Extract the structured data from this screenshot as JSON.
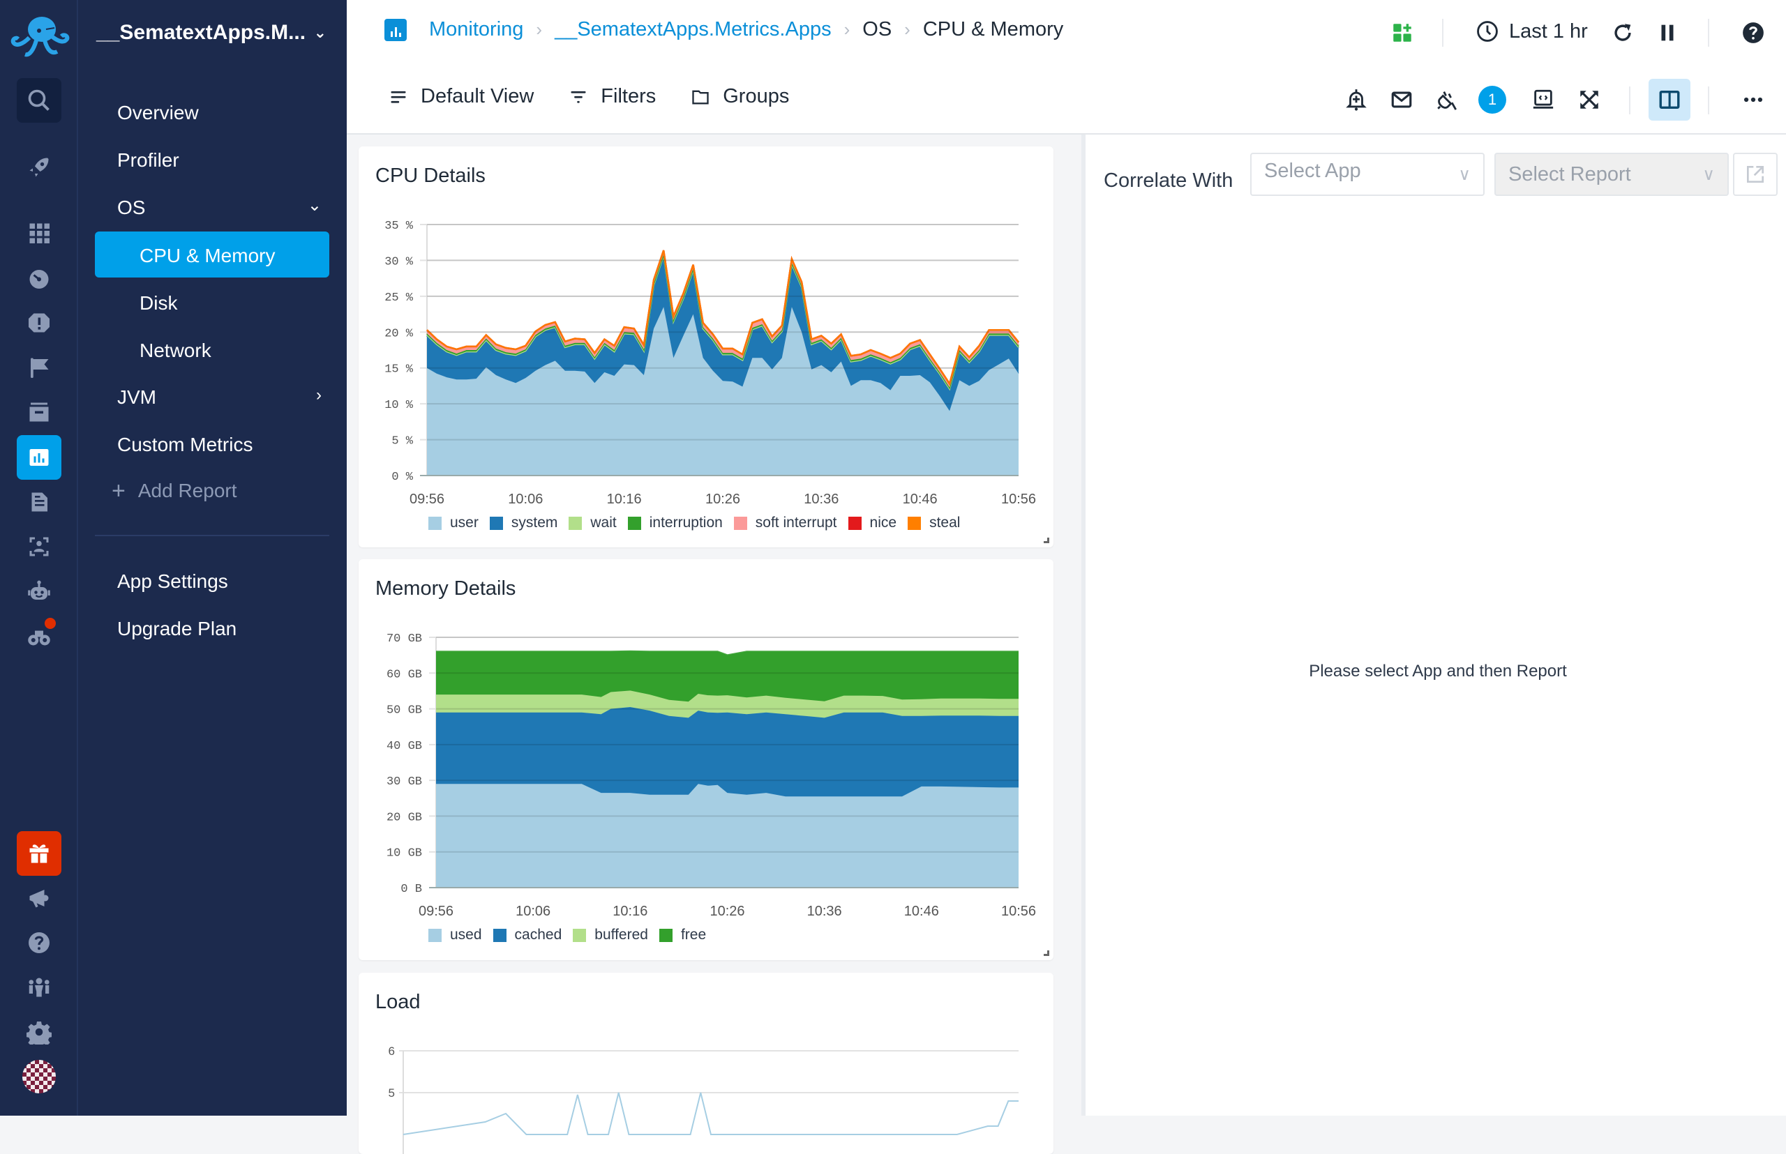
{
  "app": {
    "name": "__SematextApps.M...",
    "logo": "octopus-logo"
  },
  "rail": {
    "items": [
      {
        "name": "search-icon",
        "active": false
      },
      {
        "name": "rocket-icon",
        "active": false
      },
      {
        "name": "apps-grid-icon",
        "active": false
      },
      {
        "name": "dashboard-gauge-icon",
        "active": false
      },
      {
        "name": "alert-icon",
        "active": false
      },
      {
        "name": "flag-icon",
        "active": false
      },
      {
        "name": "archive-icon",
        "active": false
      },
      {
        "name": "monitoring-chart-icon",
        "active": true
      },
      {
        "name": "logs-document-icon",
        "active": false
      },
      {
        "name": "experience-user-scan-icon",
        "active": false
      },
      {
        "name": "synthetics-robot-icon",
        "active": false
      },
      {
        "name": "discover-binoculars-icon",
        "active": false,
        "notification": true
      }
    ],
    "bottom": [
      {
        "name": "gift-icon"
      },
      {
        "name": "announcements-megaphone-icon"
      },
      {
        "name": "help-icon"
      },
      {
        "name": "team-icon"
      },
      {
        "name": "settings-gear-icon"
      },
      {
        "name": "user-avatar"
      }
    ]
  },
  "nav": {
    "items": [
      {
        "label": "Overview"
      },
      {
        "label": "Profiler"
      },
      {
        "label": "OS",
        "expanded": true
      },
      {
        "label": "CPU & Memory",
        "active": true
      },
      {
        "label": "Disk"
      },
      {
        "label": "Network"
      },
      {
        "label": "JVM",
        "expanded": false
      },
      {
        "label": "Custom Metrics"
      },
      {
        "label": "Add Report"
      },
      {
        "label": "App Settings"
      },
      {
        "label": "Upgrade Plan"
      }
    ]
  },
  "breadcrumb": [
    "Monitoring",
    "__SematextApps.Metrics.Apps",
    "OS",
    "CPU & Memory"
  ],
  "toolbar": {
    "default_view": "Default View",
    "filters": "Filters",
    "groups": "Groups",
    "time_range": "Last 1 hr",
    "integrations_badge": "1"
  },
  "correlate": {
    "label": "Correlate With",
    "select_app_placeholder": "Select App",
    "select_report_placeholder": "Select Report",
    "empty_message": "Please select App and then Report"
  },
  "colors": {
    "accent": "#00a0e9",
    "sidebar_bg": "#1c2a4d",
    "user": "#a6cee3",
    "system": "#1f78b4",
    "wait": "#b2df8a",
    "interruption": "#33a02c",
    "soft_interrupt": "#fb9a99",
    "nice": "#e31a1c",
    "steal": "#ff7f00"
  },
  "chart_data": [
    {
      "type": "area",
      "stacked": true,
      "title": "CPU Details",
      "ylabel": "%",
      "ylim": [
        0,
        35
      ],
      "yticks": [
        "0 %",
        "5 %",
        "10 %",
        "15 %",
        "20 %",
        "25 %",
        "30 %",
        "35 %"
      ],
      "ytick_values": [
        0,
        5,
        10,
        15,
        20,
        25,
        30,
        35
      ],
      "xticks": [
        "09:56",
        "10:06",
        "10:16",
        "10:26",
        "10:36",
        "10:46",
        "10:56"
      ],
      "x_minutes": [
        0,
        1,
        2,
        3,
        4,
        5,
        6,
        7,
        8,
        9,
        10,
        11,
        12,
        13,
        14,
        15,
        16,
        17,
        18,
        19,
        20,
        21,
        22,
        23,
        24,
        25,
        26,
        27,
        28,
        29,
        30,
        31,
        32,
        33,
        34,
        35,
        36,
        37,
        38,
        39,
        40,
        41,
        42,
        43,
        44,
        45,
        46,
        47,
        48,
        49,
        50,
        51,
        52,
        53,
        54,
        55,
        56,
        57,
        58,
        59,
        60
      ],
      "legend": [
        "user",
        "system",
        "wait",
        "interruption",
        "soft interrupt",
        "nice",
        "steal"
      ],
      "legend_position": "bottom",
      "series": [
        {
          "name": "user",
          "values": [
            15,
            14.2,
            13.7,
            13.4,
            13.4,
            13.5,
            15.1,
            14.0,
            13.4,
            12.9,
            13.6,
            14.6,
            15.4,
            16.0,
            14.6,
            14.6,
            14.5,
            12.9,
            14.4,
            13.9,
            15.5,
            15.4,
            14.0,
            20.5,
            23.5,
            16.4,
            19.5,
            22.5,
            16.4,
            14.6,
            13.2,
            13.1,
            12.4,
            16.4,
            16.4,
            14.8,
            16.4,
            23.5,
            20.0,
            14.8,
            15.4,
            14.4,
            15.9,
            12.5,
            13.3,
            13.3,
            12.9,
            11.9,
            13.9,
            13.9,
            14.0,
            13.0,
            11.1,
            9.0,
            13.3,
            12.5,
            13.2,
            14.7,
            15.5,
            16.3,
            14.2
          ],
          "note": "approximate"
        },
        {
          "name": "system",
          "values": [
            4.5,
            4.0,
            3.5,
            3.3,
            3.8,
            3.7,
            3.7,
            3.4,
            3.5,
            3.8,
            3.7,
            4.7,
            4.8,
            4.6,
            3.2,
            3.6,
            3.7,
            3.3,
            3.8,
            3.3,
            4.2,
            4.2,
            3.3,
            6.0,
            7.1,
            5.0,
            5.1,
            6.1,
            4.0,
            4.2,
            3.6,
            3.7,
            3.6,
            3.9,
            4.4,
            3.7,
            3.6,
            5.9,
            6.2,
            3.4,
            3.3,
            3.1,
            3.0,
            3.3,
            2.7,
            3.3,
            3.2,
            3.6,
            2.2,
            3.6,
            4.0,
            3.0,
            3.0,
            3.0,
            3.9,
            3.2,
            4.0,
            4.8,
            4.0,
            3.2,
            3.6
          ]
        },
        {
          "name": "wait",
          "values": [
            0.1,
            0.1,
            0.1,
            0.1,
            0.1,
            0.1,
            0.1,
            0.1,
            0.1,
            0.1,
            0.1,
            0.1,
            0.1,
            0.1,
            0.1,
            0.1,
            0.1,
            0.1,
            0.1,
            0.1,
            0.1,
            0.1,
            0.1,
            0.1,
            0.1,
            0.1,
            0.1,
            0.1,
            0.1,
            0.1,
            0.1,
            0.1,
            0.1,
            0.1,
            0.1,
            0.1,
            0.1,
            0.1,
            0.1,
            0.1,
            0.1,
            0.1,
            0.1,
            0.1,
            0.1,
            0.1,
            0.1,
            0.1,
            0.1,
            0.1,
            0.1,
            0.1,
            0.1,
            0.1,
            0.1,
            0.1,
            0.1,
            0.1,
            0.1,
            0.1,
            0.1
          ]
        },
        {
          "name": "interruption",
          "values": [
            0.2,
            0.2,
            0.2,
            0.2,
            0.2,
            0.2,
            0.2,
            0.2,
            0.2,
            0.2,
            0.2,
            0.2,
            0.2,
            0.2,
            0.2,
            0.2,
            0.2,
            0.2,
            0.2,
            0.2,
            0.2,
            0.2,
            0.2,
            0.2,
            0.2,
            0.2,
            0.2,
            0.2,
            0.2,
            0.2,
            0.2,
            0.2,
            0.2,
            0.2,
            0.2,
            0.2,
            0.2,
            0.2,
            0.2,
            0.2,
            0.2,
            0.2,
            0.2,
            0.2,
            0.2,
            0.2,
            0.2,
            0.2,
            0.2,
            0.2,
            0.2,
            0.2,
            0.2,
            0.2,
            0.2,
            0.2,
            0.2,
            0.2,
            0.2,
            0.2,
            0.2
          ]
        },
        {
          "name": "soft interrupt",
          "values": [
            0.4,
            0.4,
            0.4,
            0.5,
            0.4,
            0.4,
            0.4,
            0.5,
            0.5,
            0.5,
            0.4,
            0.4,
            0.4,
            0.4,
            0.5,
            0.5,
            0.4,
            0.5,
            0.4,
            0.5,
            0.6,
            0.5,
            0.5,
            0.4,
            0.4,
            0.4,
            0.4,
            0.4,
            0.5,
            0.5,
            0.5,
            0.5,
            0.5,
            0.6,
            0.6,
            0.5,
            0.5,
            0.4,
            0.4,
            0.4,
            0.4,
            0.5,
            0.4,
            0.5,
            0.5,
            0.5,
            0.5,
            0.5,
            0.5,
            0.5,
            0.5,
            0.5,
            0.4,
            0.4,
            0.4,
            0.4,
            0.5,
            0.4,
            0.4,
            0.4,
            0.4
          ]
        },
        {
          "name": "nice",
          "values": [
            0.1,
            0.1,
            0.1,
            0.1,
            0.1,
            0.1,
            0.1,
            0.1,
            0.1,
            0.1,
            0.1,
            0.1,
            0.1,
            0.1,
            0.1,
            0.1,
            0.1,
            0.1,
            0.1,
            0.1,
            0.1,
            0.1,
            0.1,
            0.1,
            0.1,
            0.1,
            0.1,
            0.1,
            0.1,
            0.1,
            0.1,
            0.1,
            0.1,
            0.1,
            0.1,
            0.1,
            0.1,
            0.1,
            0.1,
            0.1,
            0.1,
            0.1,
            0.1,
            0.1,
            0.1,
            0.1,
            0.1,
            0.1,
            0.1,
            0.1,
            0.1,
            0.1,
            0.1,
            0.1,
            0.1,
            0.1,
            0.1,
            0.1,
            0.1,
            0.1,
            0.1
          ]
        },
        {
          "name": "steal",
          "values": [
            0,
            0,
            0,
            0,
            0,
            0,
            0,
            0,
            0,
            0,
            0,
            0,
            0,
            0,
            0,
            0,
            0,
            0,
            0,
            0,
            0,
            0,
            0,
            0,
            0,
            0,
            0,
            0,
            0,
            0,
            0,
            0,
            0,
            0,
            0,
            0,
            0,
            0,
            0,
            0,
            0,
            0,
            0,
            0,
            0,
            0,
            0,
            0,
            0,
            0,
            0,
            0,
            0,
            0,
            0,
            0,
            0,
            0,
            0,
            0,
            0
          ]
        }
      ]
    },
    {
      "type": "area",
      "stacked": true,
      "title": "Memory Details",
      "ylabel": "GB",
      "ylim": [
        0,
        70
      ],
      "yticks": [
        "0 B",
        "10 GB",
        "20 GB",
        "30 GB",
        "40 GB",
        "50 GB",
        "60 GB",
        "70 GB"
      ],
      "ytick_values": [
        0,
        10,
        20,
        30,
        40,
        50,
        60,
        70
      ],
      "xticks": [
        "09:56",
        "10:06",
        "10:16",
        "10:26",
        "10:36",
        "10:46",
        "10:56"
      ],
      "x_minutes": [
        0,
        5,
        10,
        15,
        17,
        18,
        20,
        22,
        24,
        26,
        27,
        28,
        29,
        30,
        32,
        34,
        36,
        38,
        40,
        42,
        44,
        46,
        48,
        50,
        52,
        54,
        56,
        58,
        60
      ],
      "legend": [
        "used",
        "cached",
        "buffered",
        "free"
      ],
      "legend_position": "bottom",
      "series": [
        {
          "name": "used",
          "values": [
            29,
            29,
            29,
            29,
            26.5,
            26.5,
            26.5,
            26,
            26,
            26,
            29,
            28.5,
            28.7,
            26.5,
            26,
            26.5,
            25.5,
            25.5,
            25.5,
            25.5,
            25.5,
            25.5,
            25.5,
            28.3,
            28.3,
            28.2,
            28.1,
            28.0,
            28.0
          ]
        },
        {
          "name": "cached",
          "values": [
            20,
            20,
            20,
            20,
            22,
            23.5,
            24,
            23.5,
            22,
            21.5,
            20.5,
            20.5,
            20.2,
            22.5,
            22.5,
            22.5,
            23,
            22.5,
            22,
            23.5,
            23.5,
            23.5,
            22.5,
            19.7,
            19.8,
            19.9,
            20.0,
            20.0,
            20.0
          ]
        },
        {
          "name": "buffered",
          "values": [
            5,
            5,
            5,
            5,
            4.8,
            4.7,
            4.6,
            4.5,
            4.5,
            4.5,
            4.7,
            4.8,
            4.8,
            4.8,
            4.7,
            4.7,
            4.6,
            4.6,
            4.6,
            4.7,
            4.7,
            4.6,
            4.6,
            4.7,
            4.8,
            4.8,
            4.8,
            4.8,
            4.8
          ]
        },
        {
          "name": "free",
          "values": [
            12,
            12,
            12,
            12,
            12.7,
            11.3,
            11.0,
            12.0,
            13.5,
            14,
            11.8,
            12.2,
            12.3,
            11.2,
            12.8,
            12.3,
            12.9,
            13.4,
            13.9,
            12.3,
            12.3,
            12.4,
            13.4,
            13.3,
            13.1,
            13.1,
            13.1,
            13.2,
            13.2
          ]
        }
      ]
    },
    {
      "type": "line",
      "title": "Load",
      "ylim_visible": [
        5,
        6
      ],
      "yticks": [
        "5",
        "6"
      ],
      "ytick_values": [
        5,
        6
      ],
      "series": [
        {
          "name": "load",
          "x_minutes": [
            0,
            8,
            10,
            12,
            16,
            17,
            18,
            20,
            21,
            22,
            28,
            29,
            30,
            54,
            57,
            58,
            59,
            60
          ],
          "values": [
            4.0,
            4.3,
            4.5,
            4.0,
            4.0,
            4.95,
            4.0,
            4.0,
            5.0,
            4.0,
            4.0,
            5.0,
            4.0,
            4.0,
            4.2,
            4.2,
            4.8,
            4.8
          ]
        }
      ]
    }
  ]
}
